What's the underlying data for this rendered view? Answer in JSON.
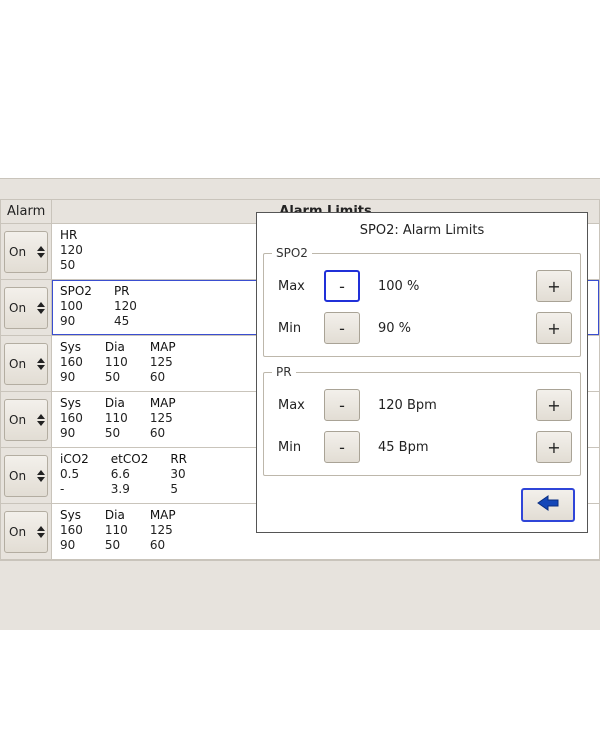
{
  "header": {
    "alarm_col": "Alarm",
    "title": "Alarm Limits"
  },
  "rows": [
    {
      "alarm": "On",
      "selected": false,
      "cols": [
        {
          "hdr": "HR",
          "hi": "120",
          "lo": "50"
        }
      ]
    },
    {
      "alarm": "On",
      "selected": true,
      "cols": [
        {
          "hdr": "SPO2",
          "hi": "100",
          "lo": "90"
        },
        {
          "hdr": "PR",
          "hi": "120",
          "lo": "45"
        }
      ]
    },
    {
      "alarm": "On",
      "selected": false,
      "cols": [
        {
          "hdr": "Sys",
          "hi": "160",
          "lo": "90"
        },
        {
          "hdr": "Dia",
          "hi": "110",
          "lo": "50"
        },
        {
          "hdr": "MAP",
          "hi": "125",
          "lo": "60"
        }
      ]
    },
    {
      "alarm": "On",
      "selected": false,
      "cols": [
        {
          "hdr": "Sys",
          "hi": "160",
          "lo": "90"
        },
        {
          "hdr": "Dia",
          "hi": "110",
          "lo": "50"
        },
        {
          "hdr": "MAP",
          "hi": "125",
          "lo": "60"
        }
      ]
    },
    {
      "alarm": "On",
      "selected": false,
      "cols": [
        {
          "hdr": "iCO2",
          "hi": "0.5",
          "lo": "-"
        },
        {
          "hdr": "etCO2",
          "hi": "6.6",
          "lo": "3.9"
        },
        {
          "hdr": "RR",
          "hi": "30",
          "lo": "5"
        }
      ]
    },
    {
      "alarm": "On",
      "selected": false,
      "cols": [
        {
          "hdr": "Sys",
          "hi": "160",
          "lo": "90"
        },
        {
          "hdr": "Dia",
          "hi": "110",
          "lo": "50"
        },
        {
          "hdr": "MAP",
          "hi": "125",
          "lo": "60"
        }
      ]
    }
  ],
  "popup": {
    "title": "SPO2: Alarm Limits",
    "groups": [
      {
        "name": "SPO2",
        "limits": [
          {
            "label": "Max",
            "value": "100 %",
            "minus": "-",
            "plus": "+",
            "focus_minus": true
          },
          {
            "label": "Min",
            "value": "90 %",
            "minus": "-",
            "plus": "+",
            "focus_minus": false
          }
        ]
      },
      {
        "name": "PR",
        "limits": [
          {
            "label": "Max",
            "value": "120 Bpm",
            "minus": "-",
            "plus": "+",
            "focus_minus": false
          },
          {
            "label": "Min",
            "value": "45 Bpm",
            "minus": "-",
            "plus": "+",
            "focus_minus": false
          }
        ]
      }
    ]
  }
}
